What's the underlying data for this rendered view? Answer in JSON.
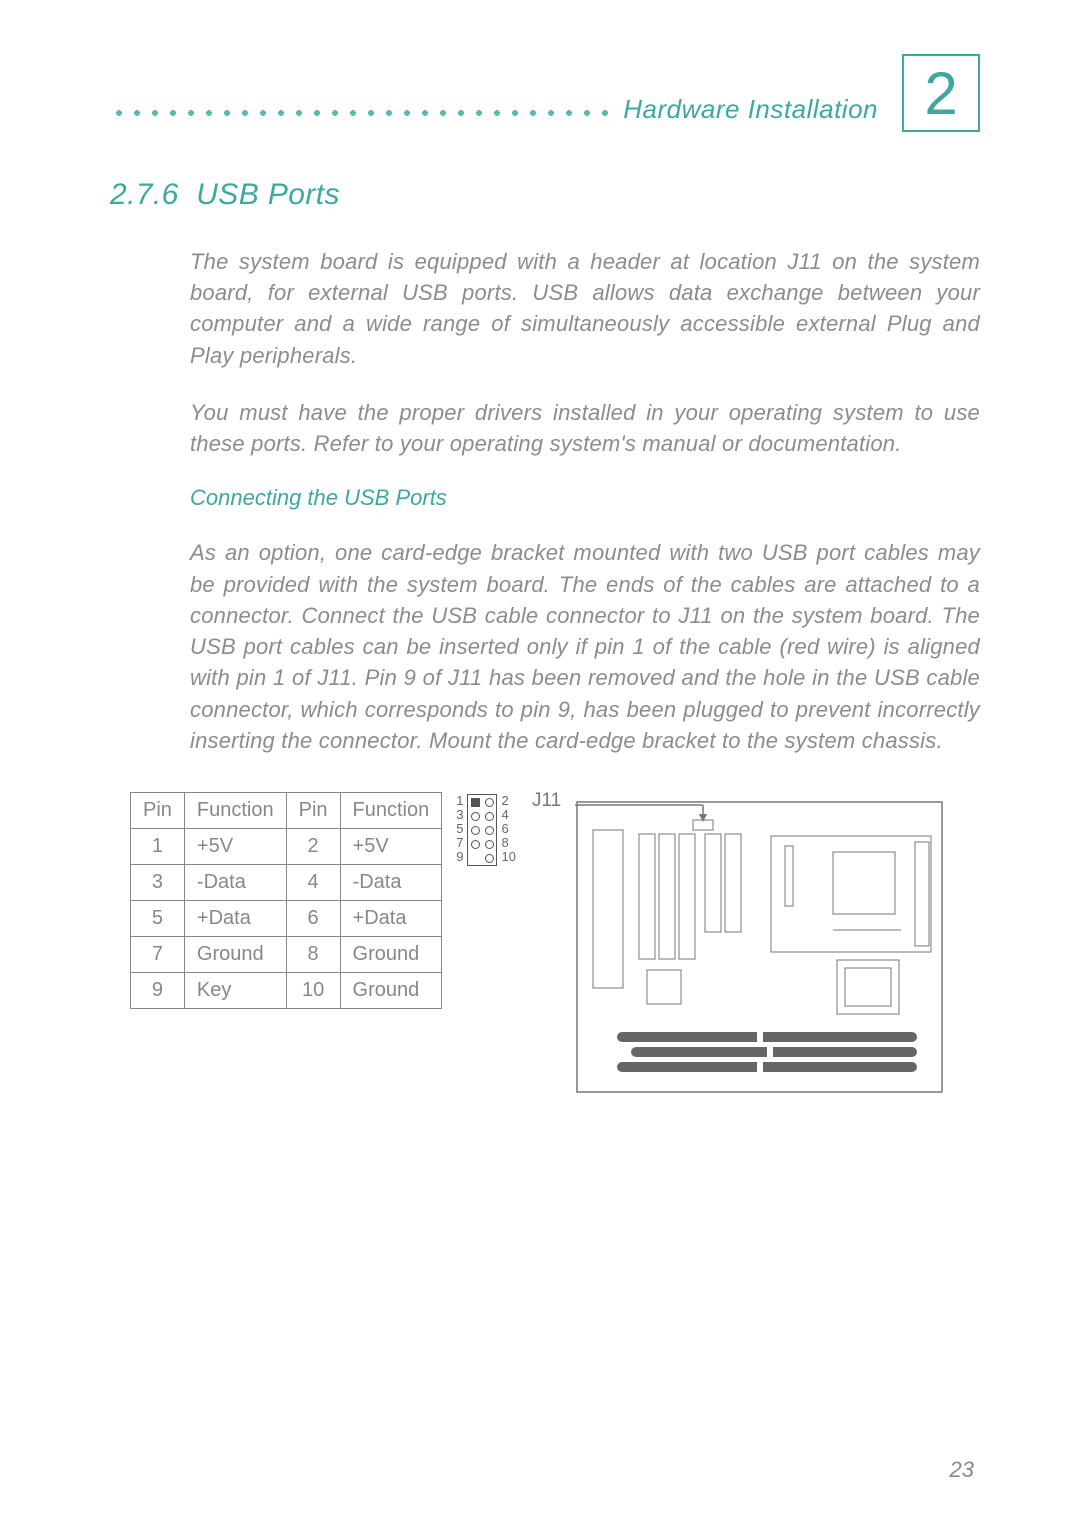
{
  "chapter": {
    "title": "Hardware Installation",
    "number": "2"
  },
  "section": {
    "number": "2.7.6",
    "title": "USB Ports"
  },
  "paragraphs": {
    "p1": "The system board is equipped with a header at location J11 on the system board, for external USB ports. USB allows data exchange between your computer and a wide range of simultaneously accessible external Plug and Play peripherals.",
    "p2": "You must have the proper drivers installed in your operating system to use these ports. Refer to your operating system's manual or documentation.",
    "sub_heading": "Connecting the USB Ports",
    "p3": "As an option, one card-edge bracket mounted with two USB port cables may be provided with the system board. The ends of the cables are attached to a connector. Connect the USB cable connector to J11 on the system board. The USB port cables can be inserted only if pin 1 of the cable (red wire) is aligned with pin 1 of J11. Pin 9 of J11 has been removed and the hole in the USB cable connector, which corresponds to pin 9, has been plugged to prevent incorrectly inserting the connector. Mount the card-edge bracket to the system chassis."
  },
  "pin_table": {
    "headers": [
      "Pin",
      "Function",
      "Pin",
      "Function"
    ],
    "rows": [
      [
        "1",
        "+5V",
        "2",
        "+5V"
      ],
      [
        "3",
        "-Data",
        "4",
        "-Data"
      ],
      [
        "5",
        "+Data",
        "6",
        "+Data"
      ],
      [
        "7",
        "Ground",
        "8",
        "Ground"
      ],
      [
        "9",
        "Key",
        "10",
        "Ground"
      ]
    ]
  },
  "header_diagram": {
    "left_labels": [
      "1",
      "3",
      "5",
      "7",
      "9"
    ],
    "right_labels": [
      "2",
      "4",
      "6",
      "8",
      "10"
    ],
    "label": "J11"
  },
  "page_number": "23"
}
